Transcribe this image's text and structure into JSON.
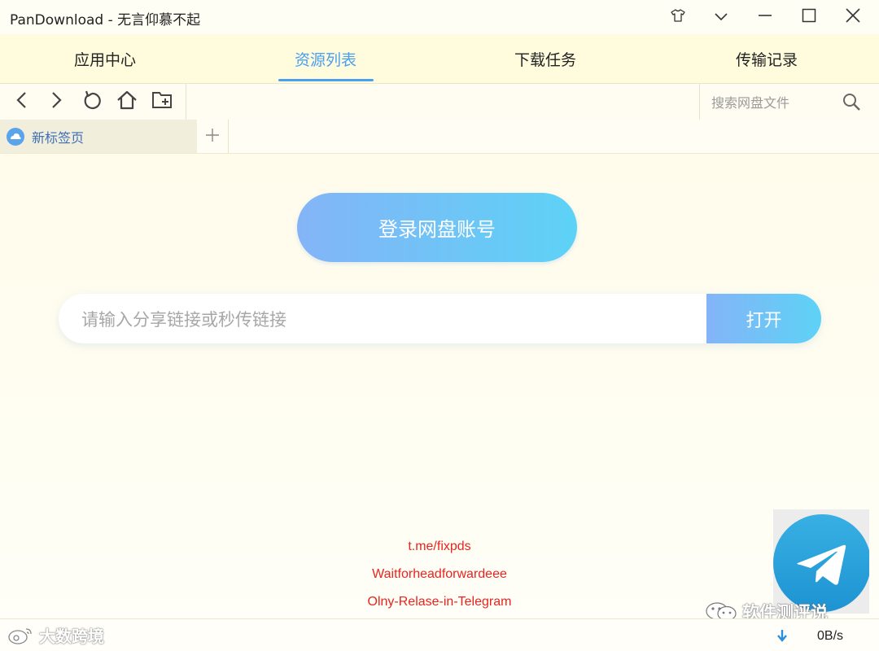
{
  "window": {
    "title": "PanDownload - 无言仰慕不起"
  },
  "main_tabs": [
    {
      "label": "应用中心"
    },
    {
      "label": "资源列表"
    },
    {
      "label": "下载任务"
    },
    {
      "label": "传输记录"
    }
  ],
  "active_tab_index": 1,
  "search": {
    "placeholder": "搜索网盘文件",
    "value": ""
  },
  "page_tabs": [
    {
      "label": "新标签页"
    }
  ],
  "content": {
    "login_button": "登录网盘账号",
    "link_input_placeholder": "请输入分享链接或秒传链接",
    "link_input_value": "",
    "open_button": "打开"
  },
  "footer_lines": [
    "t.me/fixpds",
    "Waitforheadforwardeee",
    "Olny-Relase-in-Telegram"
  ],
  "status": {
    "speed": "0B/s"
  },
  "watermarks": {
    "left": "大数跨境",
    "right": "软件测评说"
  },
  "colors": {
    "accent": "#4aa0ef",
    "red_text": "#e8241f",
    "gradient_start": "#84b4f7",
    "gradient_end": "#5dd2f6"
  },
  "icons": [
    "shirt-icon",
    "chevron-down-icon",
    "minimize-icon",
    "maximize-icon",
    "close-icon",
    "back-icon",
    "forward-icon",
    "refresh-icon",
    "home-icon",
    "new-folder-icon",
    "search-icon",
    "cloud-icon",
    "plus-icon",
    "download-arrow-icon",
    "telegram-icon",
    "weibo-icon",
    "wechat-icon"
  ]
}
